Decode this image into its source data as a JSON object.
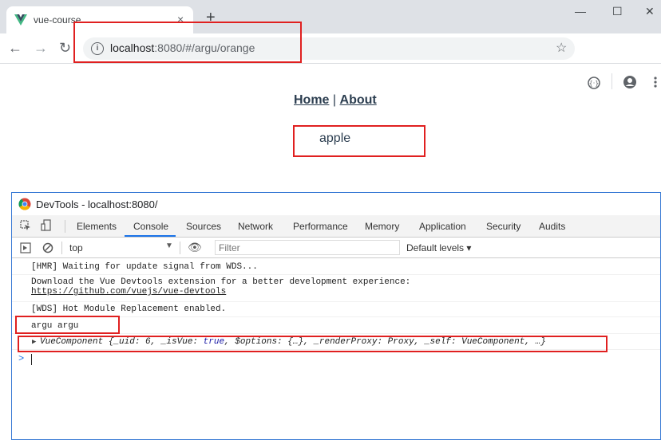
{
  "browser": {
    "tab_title": "vue-course",
    "tab_close": "×",
    "new_tab": "+",
    "window_controls": {
      "minimize": "—",
      "maximize": "☐",
      "close": "✕"
    },
    "nav": {
      "back": "←",
      "forward": "→",
      "reload": "↻"
    },
    "url_host": "localhost",
    "url_rest": ":8080/#/argu/orange",
    "star": "☆"
  },
  "page": {
    "nav_home": "Home",
    "nav_sep": "|",
    "nav_about": "About",
    "content": "apple"
  },
  "devtools": {
    "title": "DevTools - localhost:8080/",
    "tabs": [
      "Elements",
      "Console",
      "Sources",
      "Network",
      "Performance",
      "Memory",
      "Application",
      "Security",
      "Audits"
    ],
    "active_tab": "Console",
    "context": "top",
    "filter_placeholder": "Filter",
    "levels": "Default levels ▾",
    "console_lines": {
      "hmr": "[HMR] Waiting for update signal from WDS...",
      "devtools_msg": "Download the Vue Devtools extension for a better development experience:",
      "devtools_link": "https://github.com/vuejs/vue-devtools",
      "wds": "[WDS] Hot Module Replacement enabled.",
      "argu": "argu argu",
      "component_prefix": "VueComponent {_uid: 6, _isVue: ",
      "component_true": "true",
      "component_mid": ", $options: {…}, _renderProxy: Proxy, _self: VueComponent, …}"
    },
    "prompt": ">"
  },
  "colors": {
    "highlight": "#e02020",
    "vue_green": "#41b883",
    "active_tab": "#1a73e8"
  }
}
